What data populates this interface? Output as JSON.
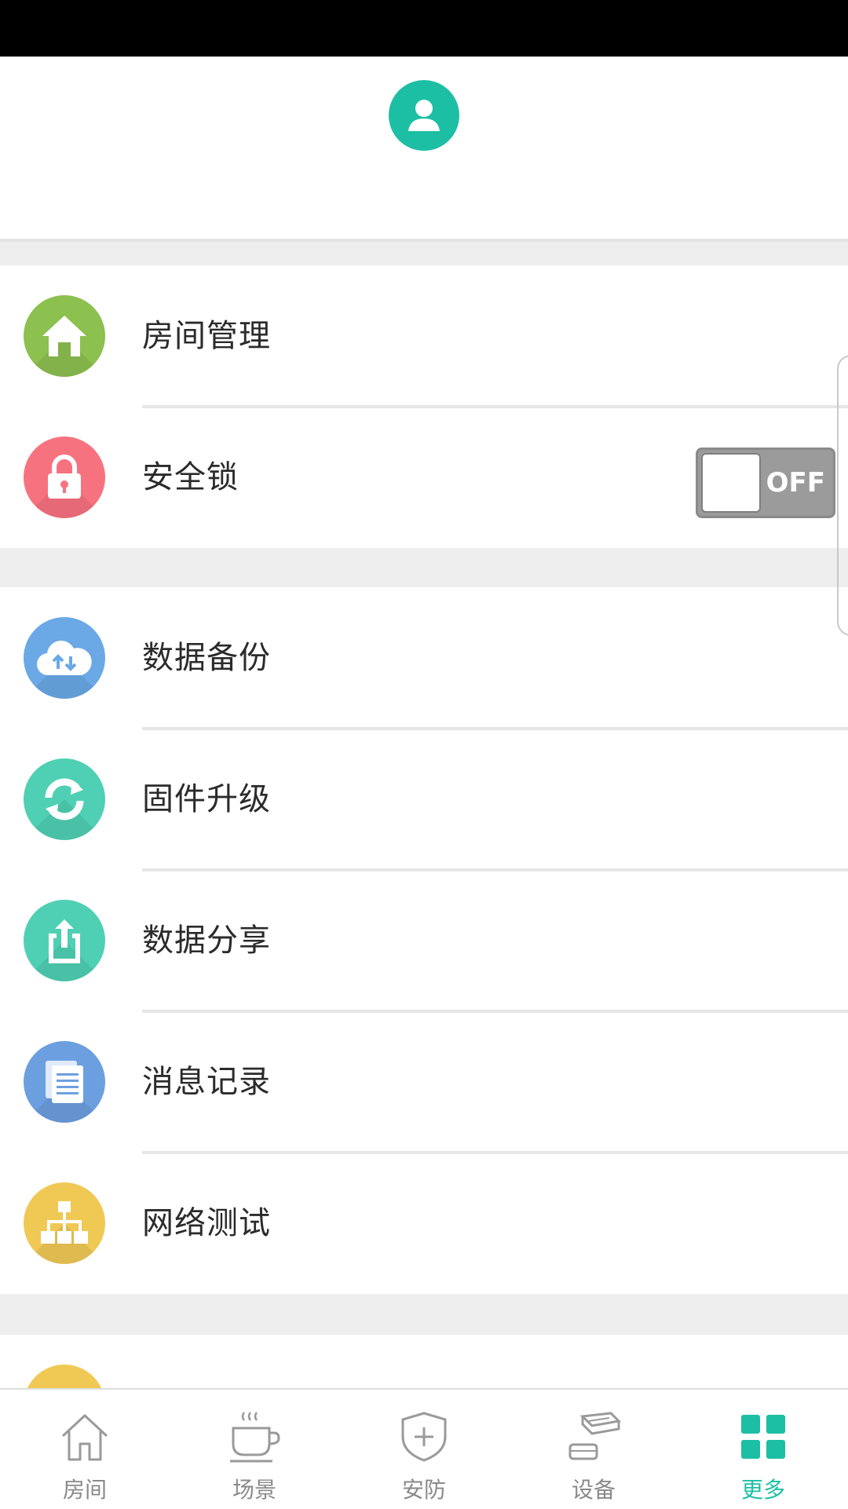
{
  "colors": {
    "accent": "#1cbfa4",
    "room_icon": "#8cc04f",
    "lock_icon": "#f7727f",
    "backup_icon": "#6aa8e6",
    "firmware_icon": "#4fd0b4",
    "share_icon": "#4fd0b4",
    "message_icon": "#6c9fe0",
    "network_icon": "#f0c955"
  },
  "menu": {
    "group1": [
      {
        "label": "房间管理",
        "icon": "house-icon"
      },
      {
        "label": "安全锁",
        "icon": "padlock-icon"
      }
    ],
    "group2": [
      {
        "label": "数据备份",
        "icon": "cloud-sync-icon"
      },
      {
        "label": "固件升级",
        "icon": "refresh-icon"
      },
      {
        "label": "数据分享",
        "icon": "share-upload-icon"
      },
      {
        "label": "消息记录",
        "icon": "document-icon"
      },
      {
        "label": "网络测试",
        "icon": "network-tree-icon"
      }
    ]
  },
  "security_lock_toggle": {
    "state": "OFF"
  },
  "tabs": [
    {
      "label": "房间",
      "icon": "house-outline-icon",
      "active": false
    },
    {
      "label": "场景",
      "icon": "coffee-cup-icon",
      "active": false
    },
    {
      "label": "安防",
      "icon": "shield-plus-icon",
      "active": false
    },
    {
      "label": "设备",
      "icon": "device-stack-icon",
      "active": false
    },
    {
      "label": "更多",
      "icon": "grid-icon",
      "active": true
    }
  ]
}
